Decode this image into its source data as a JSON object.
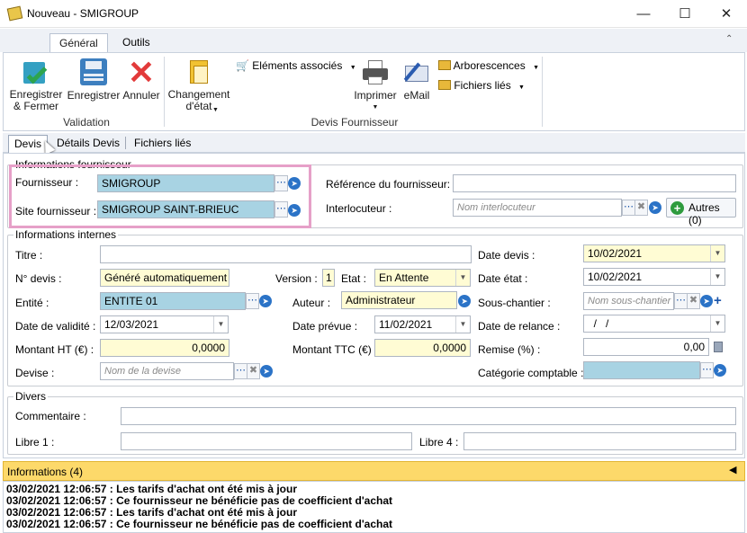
{
  "window": {
    "title": "Nouveau - SMIGROUP"
  },
  "ribbon": {
    "tabs": [
      "Général",
      "Outils"
    ],
    "validation": {
      "save_close": "Enregistrer\n& Fermer",
      "save": "Enregistrer",
      "cancel": "Annuler",
      "group_label": "Validation"
    },
    "devis": {
      "change_state": "Changement\nd'état",
      "associated": "Eléments associés",
      "print": "Imprimer",
      "email": "eMail",
      "trees": "Arborescences",
      "linked_files": "Fichiers liés",
      "group_label": "Devis Fournisseur"
    }
  },
  "doc_tabs": [
    "Devis",
    "Détails Devis",
    "Fichiers liés"
  ],
  "supplier": {
    "legend": "Informations fournisseur",
    "fournisseur_label": "Fournisseur :",
    "fournisseur_value": "SMIGROUP",
    "site_label": "Site fournisseur :",
    "site_value": "SMIGROUP SAINT-BRIEUC",
    "ref_label": "Référence du fournisseur:",
    "ref_value": "",
    "interlocuteur_label": "Interlocuteur :",
    "interlocuteur_placeholder": "Nom interlocuteur",
    "autres_label": "Autres (0)"
  },
  "internal": {
    "legend": "Informations internes",
    "titre_label": "Titre :",
    "titre_value": "",
    "date_devis_label": "Date devis :",
    "date_devis_value": "10/02/2021",
    "ndevis_label": "N° devis :",
    "ndevis_value": "Généré automatiquement",
    "version_label": "Version :",
    "version_value": "1",
    "etat_label": "Etat :",
    "etat_value": "En Attente",
    "date_etat_label": "Date état :",
    "date_etat_value": "10/02/2021",
    "entite_label": "Entité :",
    "entite_value": "ENTITE 01",
    "auteur_label": "Auteur :",
    "auteur_value": "Administrateur",
    "sous_chantier_label": "Sous-chantier :",
    "sous_chantier_placeholder": "Nom sous-chantier",
    "validite_label": "Date de validité :",
    "validite_value": "12/03/2021",
    "prevue_label": "Date prévue :",
    "prevue_value": "11/02/2021",
    "relance_label": "Date de relance :",
    "relance_value": "  /   /",
    "ht_label": "Montant HT (€) :",
    "ht_value": "0,0000",
    "ttc_label": "Montant TTC (€) :",
    "ttc_value": "0,0000",
    "remise_label": "Remise (%) :",
    "remise_value": "0,00",
    "devise_label": "Devise :",
    "devise_placeholder": "Nom de la devise",
    "categorie_label": "Catégorie comptable :",
    "categorie_value": ""
  },
  "divers": {
    "legend": "Divers",
    "commentaire_label": "Commentaire :",
    "libre1_label": "Libre 1 :",
    "libre4_label": "Libre 4 :"
  },
  "info": {
    "title": "Informations (4)",
    "messages": [
      "03/02/2021 12:06:57 : Les tarifs d'achat ont été mis à jour",
      "03/02/2021 12:06:57 : Ce fournisseur ne bénéficie pas de coefficient d'achat",
      "03/02/2021 12:06:57 : Les tarifs d'achat ont été mis à jour",
      "03/02/2021 12:06:57 : Ce fournisseur ne bénéficie pas de coefficient d'achat"
    ]
  }
}
